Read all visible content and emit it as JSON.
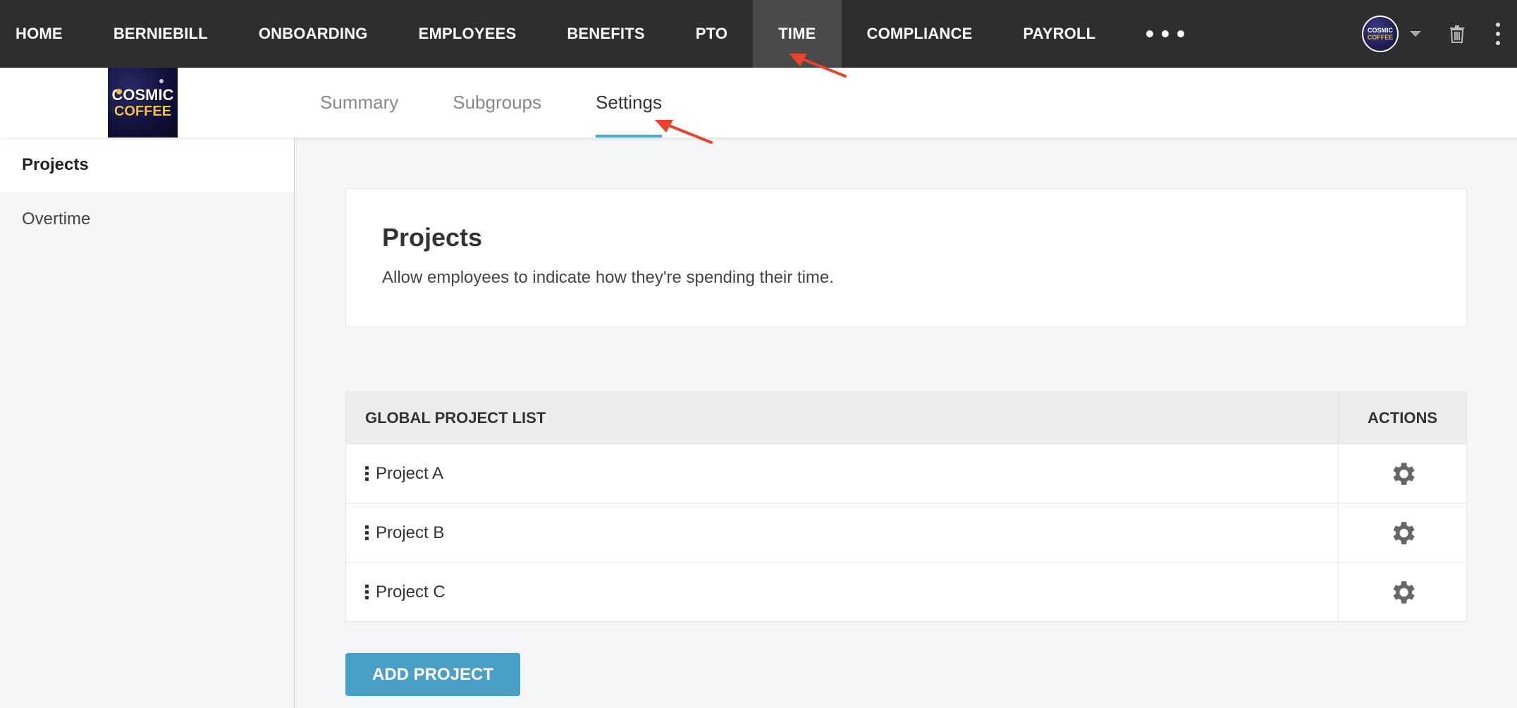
{
  "nav": {
    "items": [
      {
        "label": "HOME",
        "name": "nav-home"
      },
      {
        "label": "BERNIEBILL",
        "name": "nav-berniebill"
      },
      {
        "label": "ONBOARDING",
        "name": "nav-onboarding"
      },
      {
        "label": "EMPLOYEES",
        "name": "nav-employees"
      },
      {
        "label": "BENEFITS",
        "name": "nav-benefits"
      },
      {
        "label": "PTO",
        "name": "nav-pto"
      },
      {
        "label": "TIME",
        "name": "nav-time"
      },
      {
        "label": "COMPLIANCE",
        "name": "nav-compliance"
      },
      {
        "label": "PAYROLL",
        "name": "nav-payroll"
      }
    ],
    "active": "TIME",
    "avatar_line1": "COSMIC",
    "avatar_line2": "COFFEE"
  },
  "logo": {
    "line1": "COSMIC",
    "line2": "COFFEE"
  },
  "tabs": [
    "Summary",
    "Subgroups",
    "Settings"
  ],
  "active_tab": "Settings",
  "sidebar": {
    "items": [
      "Projects",
      "Overtime"
    ],
    "active": "Projects"
  },
  "card": {
    "title": "Projects",
    "description": "Allow employees to indicate how they're spending their time."
  },
  "table": {
    "header_name": "GLOBAL PROJECT LIST",
    "header_actions": "ACTIONS",
    "rows": [
      "Project A",
      "Project B",
      "Project C"
    ]
  },
  "add_button": "ADD PROJECT",
  "colors": {
    "topbar": "#2e2e2e",
    "accent": "#4ba6d4",
    "button": "#4a9fc6",
    "annotation_arrow": "#e8432e"
  }
}
